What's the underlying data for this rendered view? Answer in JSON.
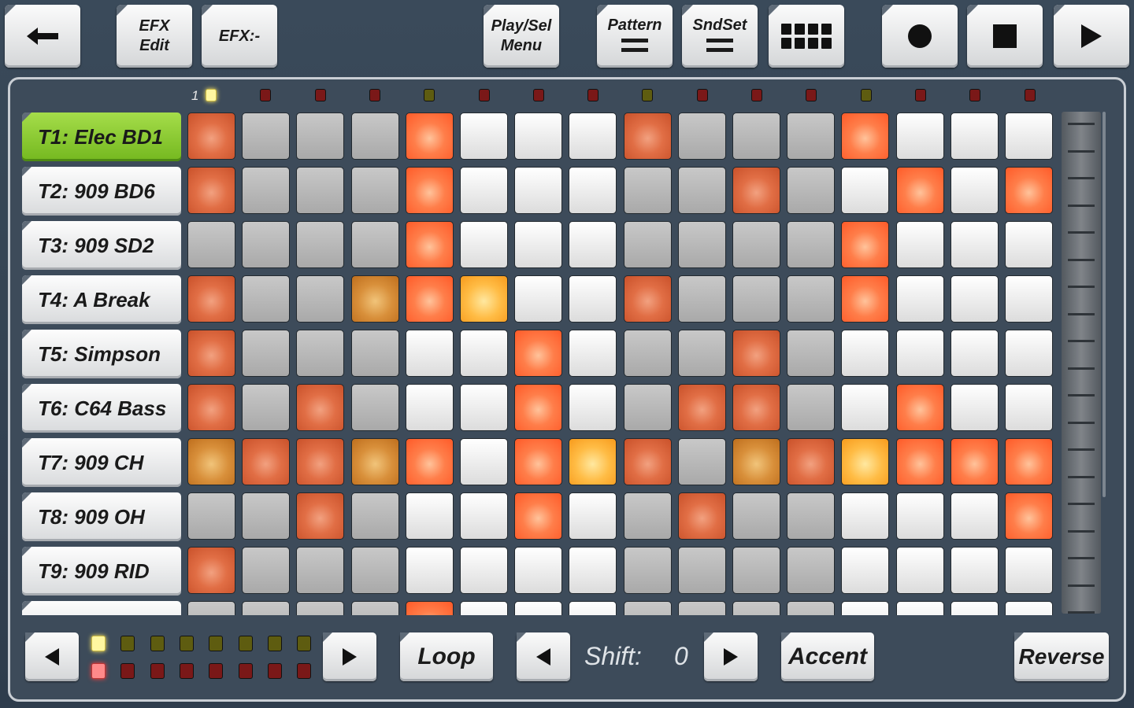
{
  "toolbar": {
    "back_icon": "arrow-left-icon",
    "efx_edit_line1": "EFX",
    "efx_edit_line2": "Edit",
    "efx_value": "EFX:-",
    "playsel_line1": "Play/Sel",
    "playsel_line2": "Menu",
    "pattern": "Pattern",
    "sndset": "SndSet",
    "grid_icon": "grid-icon",
    "record_icon": "record-icon",
    "stop_icon": "stop-icon",
    "play_icon": "play-icon"
  },
  "step_indicator": {
    "first_label": "1",
    "leds": [
      "yellow",
      "red",
      "red",
      "red",
      "olive",
      "red",
      "red",
      "red",
      "olive",
      "red",
      "red",
      "red",
      "olive",
      "red",
      "red",
      "red"
    ]
  },
  "tracks": [
    {
      "label": "T1: Elec BD1",
      "selected": true,
      "steps": [
        "o1",
        "g",
        "g",
        "g",
        "o2",
        "w",
        "w",
        "w",
        "o1",
        "g",
        "g",
        "g",
        "o2",
        "w",
        "w",
        "w"
      ]
    },
    {
      "label": "T2: 909 BD6",
      "selected": false,
      "steps": [
        "o1",
        "g",
        "g",
        "g",
        "o2",
        "w",
        "w",
        "w",
        "g",
        "g",
        "o1",
        "g",
        "w",
        "o2",
        "w",
        "o2"
      ]
    },
    {
      "label": "T3: 909 SD2",
      "selected": false,
      "steps": [
        "g",
        "g",
        "g",
        "g",
        "o2",
        "w",
        "w",
        "w",
        "g",
        "g",
        "g",
        "g",
        "o2",
        "w",
        "w",
        "w"
      ]
    },
    {
      "label": "T4: A Break",
      "selected": false,
      "steps": [
        "o1",
        "g",
        "g",
        "a1",
        "o2",
        "a2",
        "w",
        "w",
        "o1",
        "g",
        "g",
        "g",
        "o2",
        "w",
        "w",
        "w"
      ]
    },
    {
      "label": "T5: Simpson",
      "selected": false,
      "steps": [
        "o1",
        "g",
        "g",
        "g",
        "w",
        "w",
        "o2",
        "w",
        "g",
        "g",
        "o1",
        "g",
        "w",
        "w",
        "w",
        "w"
      ]
    },
    {
      "label": "T6: C64 Bass",
      "selected": false,
      "steps": [
        "o1",
        "g",
        "o1",
        "g",
        "w",
        "w",
        "o2",
        "w",
        "g",
        "o1",
        "o1",
        "g",
        "w",
        "o2",
        "w",
        "w"
      ]
    },
    {
      "label": "T7: 909 CH",
      "selected": false,
      "steps": [
        "a1",
        "o1",
        "o1",
        "a1",
        "o2",
        "w",
        "o2",
        "a2",
        "o1",
        "g",
        "a1",
        "o1",
        "a2",
        "o2",
        "o2",
        "o2"
      ]
    },
    {
      "label": "T8: 909 OH",
      "selected": false,
      "steps": [
        "g",
        "g",
        "o1",
        "g",
        "w",
        "w",
        "o2",
        "w",
        "g",
        "o1",
        "g",
        "g",
        "w",
        "w",
        "w",
        "o2"
      ]
    },
    {
      "label": "T9: 909 RID",
      "selected": false,
      "steps": [
        "o1",
        "g",
        "g",
        "g",
        "w",
        "w",
        "w",
        "w",
        "g",
        "g",
        "g",
        "g",
        "w",
        "w",
        "w",
        "w"
      ]
    },
    {
      "label": "",
      "selected": false,
      "steps": [
        "g",
        "g",
        "g",
        "g",
        "o2",
        "w",
        "w",
        "w",
        "g",
        "g",
        "g",
        "g",
        "w",
        "w",
        "w",
        "w"
      ]
    }
  ],
  "pattern_pager": {
    "prev_icon": "triangle-left-icon",
    "next_icon": "triangle-right-icon",
    "top_leds": [
      "yellow",
      "olive",
      "olive",
      "olive",
      "olive",
      "olive",
      "olive",
      "olive"
    ],
    "bottom_leds": [
      "pink",
      "red",
      "red",
      "red",
      "red",
      "red",
      "red",
      "red"
    ]
  },
  "bottom": {
    "loop": "Loop",
    "shift_label": "Shift:",
    "shift_value": "0",
    "accent": "Accent",
    "reverse": "Reverse"
  }
}
